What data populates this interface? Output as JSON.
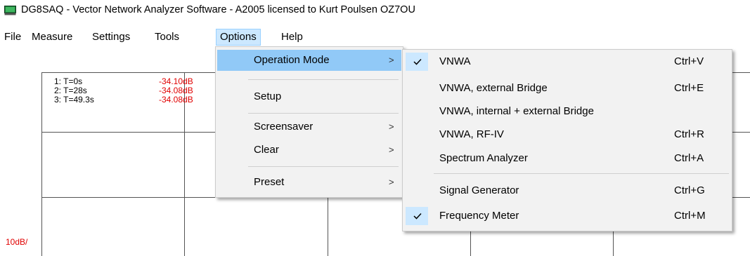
{
  "window": {
    "title": "DG8SAQ  -  Vector Network Analyzer Software  - A2005 licensed to Kurt Poulsen OZ7OU"
  },
  "menubar": {
    "items": [
      "File",
      "Measure",
      "Settings",
      "Tools",
      "Options",
      "Help"
    ],
    "active": "Options"
  },
  "plot": {
    "markers": [
      {
        "label": "1: T=0s",
        "value": "-34.10dB"
      },
      {
        "label": "2: T=28s",
        "value": "-34.08dB"
      },
      {
        "label": "3: T=49.3s",
        "value": "-34.08dB"
      }
    ],
    "scale_label": "10dB/"
  },
  "options_menu": {
    "items": [
      {
        "label": "Operation Mode",
        "has_submenu": true,
        "highlighted": true
      },
      {
        "label": "Setup",
        "has_submenu": false
      },
      {
        "label": "Screensaver",
        "has_submenu": true
      },
      {
        "label": "Clear",
        "has_submenu": true
      },
      {
        "label": "Preset",
        "has_submenu": true
      }
    ]
  },
  "operation_mode_menu": {
    "items": [
      {
        "label": "VNWA",
        "shortcut": "Ctrl+V",
        "checked": true
      },
      {
        "label": "VNWA, external Bridge",
        "shortcut": "Ctrl+E",
        "checked": false
      },
      {
        "label": "VNWA, internal + external Bridge",
        "shortcut": "",
        "checked": false
      },
      {
        "label": "VNWA, RF-IV",
        "shortcut": "Ctrl+R",
        "checked": false
      },
      {
        "label": "Spectrum Analyzer",
        "shortcut": "Ctrl+A",
        "checked": false
      },
      {
        "label": "Signal Generator",
        "shortcut": "Ctrl+G",
        "checked": false
      },
      {
        "label": "Frequency Meter",
        "shortcut": "Ctrl+M",
        "checked": true
      }
    ]
  },
  "colors": {
    "menu_highlight": "#91c9f7",
    "menubar_active": "#cce8ff",
    "marker_value": "#e00000",
    "check_highlight": "#cce8ff"
  },
  "icons": {
    "app": "vna-app-icon",
    "submenu": "chevron-right-icon",
    "check": "checkmark-icon"
  }
}
